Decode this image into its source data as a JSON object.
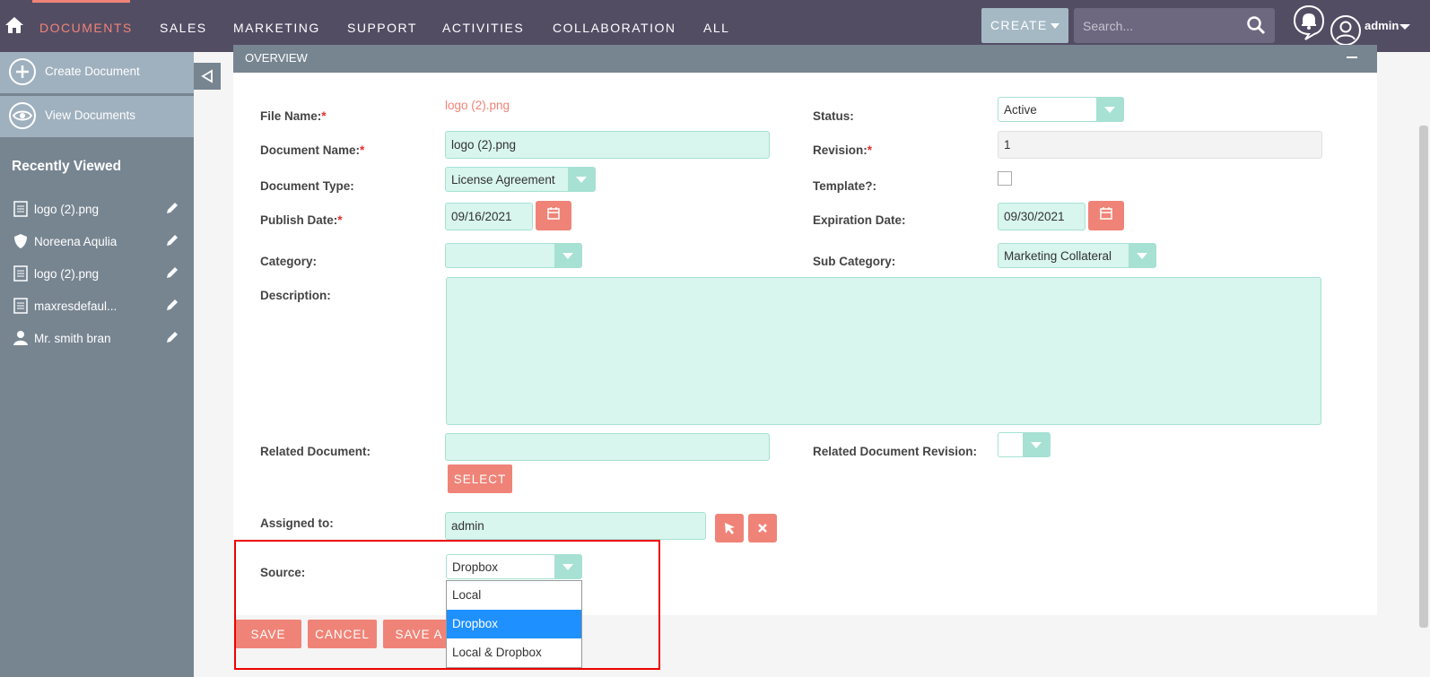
{
  "nav": {
    "items": [
      "DOCUMENTS",
      "SALES",
      "MARKETING",
      "SUPPORT",
      "ACTIVITIES",
      "COLLABORATION",
      "ALL"
    ],
    "active": "DOCUMENTS",
    "create_label": "CREATE",
    "search_placeholder": "Search...",
    "user": "admin"
  },
  "sidebar": {
    "actions": [
      "Create Document",
      "View Documents"
    ],
    "recent_title": "Recently Viewed",
    "recent": [
      {
        "label": "logo (2).png",
        "icon": "document-icon"
      },
      {
        "label": "Noreena Aqulia",
        "icon": "shield-icon"
      },
      {
        "label": "logo (2).png",
        "icon": "document-icon"
      },
      {
        "label": "maxresdefaul...",
        "icon": "document-icon"
      },
      {
        "label": "Mr. smith bran",
        "icon": "person-icon"
      }
    ]
  },
  "panel": {
    "header": "OVERVIEW",
    "fields": {
      "file_name_label": "File Name:",
      "file_name_value": "logo (2).png",
      "status_label": "Status:",
      "status_value": "Active",
      "doc_name_label": "Document Name:",
      "doc_name_value": "logo (2).png",
      "revision_label": "Revision:",
      "revision_value": "1",
      "doc_type_label": "Document Type:",
      "doc_type_value": "License Agreement",
      "template_label": "Template?:",
      "publish_label": "Publish Date:",
      "publish_value": "09/16/2021",
      "expiration_label": "Expiration Date:",
      "expiration_value": "09/30/2021",
      "category_label": "Category:",
      "category_value": "",
      "subcategory_label": "Sub Category:",
      "subcategory_value": "Marketing Collateral",
      "description_label": "Description:",
      "related_doc_label": "Related Document:",
      "related_rev_label": "Related Document Revision:",
      "select_button": "SELECT",
      "assigned_label": "Assigned to:",
      "assigned_value": "admin",
      "source_label": "Source:",
      "source_value": "Dropbox"
    },
    "source_options": [
      "Local",
      "Dropbox",
      "Local & Dropbox"
    ],
    "buttons": {
      "save": "SAVE",
      "cancel": "CANCEL",
      "save_and": "SAVE A"
    }
  },
  "colors": {
    "accent": "#f08377",
    "nav_bg": "#534d64",
    "sidebar_bg": "#778591",
    "field_bg": "#d8f5ee"
  }
}
